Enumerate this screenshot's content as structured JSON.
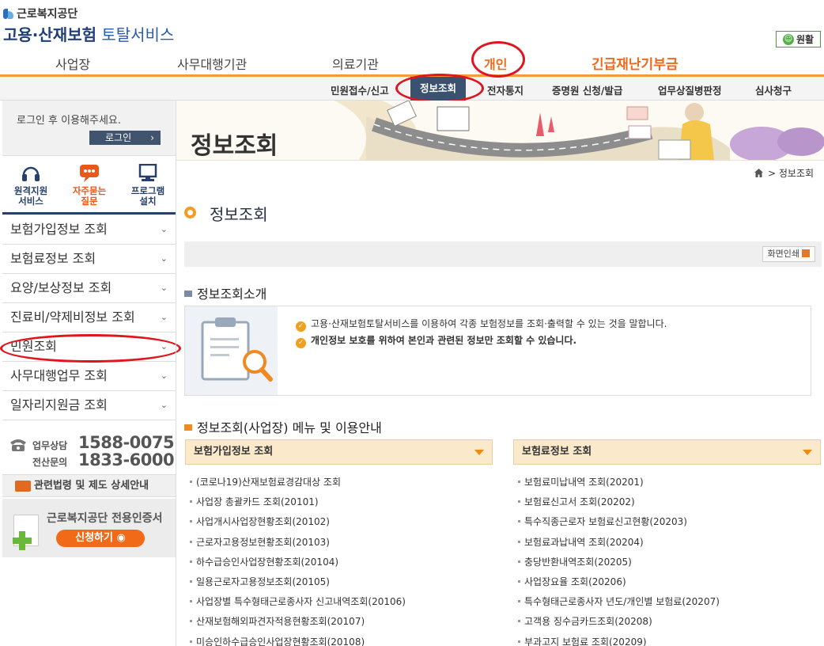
{
  "header": {
    "org_name": "근로복지공단",
    "service_name_bold": "고용·산재보험",
    "service_name_suffix": " 토탈서비스",
    "smooth_label": "원활",
    "gnb": [
      "사업장",
      "사무대행기관",
      "의료기관",
      "개인",
      "긴급재난기부금"
    ],
    "active_gnb": "개인"
  },
  "sub_nav": {
    "items": [
      "민원접수/신고",
      "정보조회",
      "전자통지",
      "증명원 신청/발급",
      "업무상질병판정",
      "심사청구"
    ],
    "active": "정보조회"
  },
  "sidebar": {
    "login_message": "로그인 후 이용해주세요.",
    "login_button": "로그인",
    "login_arrow": "›",
    "quick_links": [
      {
        "label1": "원격지원",
        "label2": "서비스",
        "icon": "headset-icon",
        "color": "#27406a"
      },
      {
        "label1": "자주묻는",
        "label2": "질문",
        "icon": "speech-bubble-icon",
        "color": "#e8581a"
      },
      {
        "label1": "프로그램",
        "label2": "설치",
        "icon": "monitor-icon",
        "color": "#27406a"
      }
    ],
    "menu": [
      "보험가입정보 조회",
      "보험료정보 조회",
      "요양/보상정보 조회",
      "진료비/약제비정보 조회",
      "민원조회",
      "사무대행업무 조회",
      "일자리지원금 조회"
    ],
    "highlighted_menu": "민원조회",
    "contact": {
      "business_label": "업무상담",
      "business_number": "1588-0075",
      "it_label": "전산문의",
      "it_number": "1833-6000"
    },
    "law_link": "관련법령 및 제도 상세안내",
    "cert": {
      "title": "근로복지공단 전용인증서",
      "button": "신청하기"
    }
  },
  "main": {
    "banner_title": "정보조회",
    "breadcrumb": "> 정보조회",
    "page_title": "정보조회",
    "print_button": "화면인쇄",
    "intro_title": "정보조회소개",
    "intro_lines": [
      "고용·산재보험토탈서비스를 이용하여 각종 보험정보를 조회·출력할 수 있는 것을 말합니다.",
      "개인정보 보호를 위하여 본인과 관련된 정보만 조회할 수 있습니다."
    ],
    "menu_section_title": "정보조회(사업장) 메뉴 및 이용안내",
    "columns": [
      {
        "title": "보험가입정보 조회",
        "items": [
          "(코로나19)산재보험료경감대상 조회",
          "사업장 총괄카드 조회(20101)",
          "사업개시사업장현황조회(20102)",
          "근로자고용정보현황조회(20103)",
          "하수급승인사업장현황조회(20104)",
          "일용근로자고용정보조회(20105)",
          "사업장별 특수형태근로종사자 신고내역조회(20106)",
          "산재보험해외파견자적용현황조회(20107)",
          "미승인하수급승인사업장현황조회(20108)"
        ]
      },
      {
        "title": "보험료정보 조회",
        "items": [
          "보험료미납내역 조회(20201)",
          "보험료신고서 조회(20202)",
          "특수직종근로자 보험료신고현황(20203)",
          "보험료과납내역 조회(20204)",
          "충당반환내역조회(20205)",
          "사업장요율 조회(20206)",
          "특수형태근로종사자 년도/개인별 보험료(20207)",
          "고객용 징수금카드조회(20208)",
          "부과고지 보험료 조회(20209)"
        ]
      }
    ]
  },
  "colors": {
    "accent_orange": "#f39b3a",
    "navy": "#27406a",
    "annotation_red": "#e0151e",
    "active_tab_bg": "#3a5270"
  }
}
